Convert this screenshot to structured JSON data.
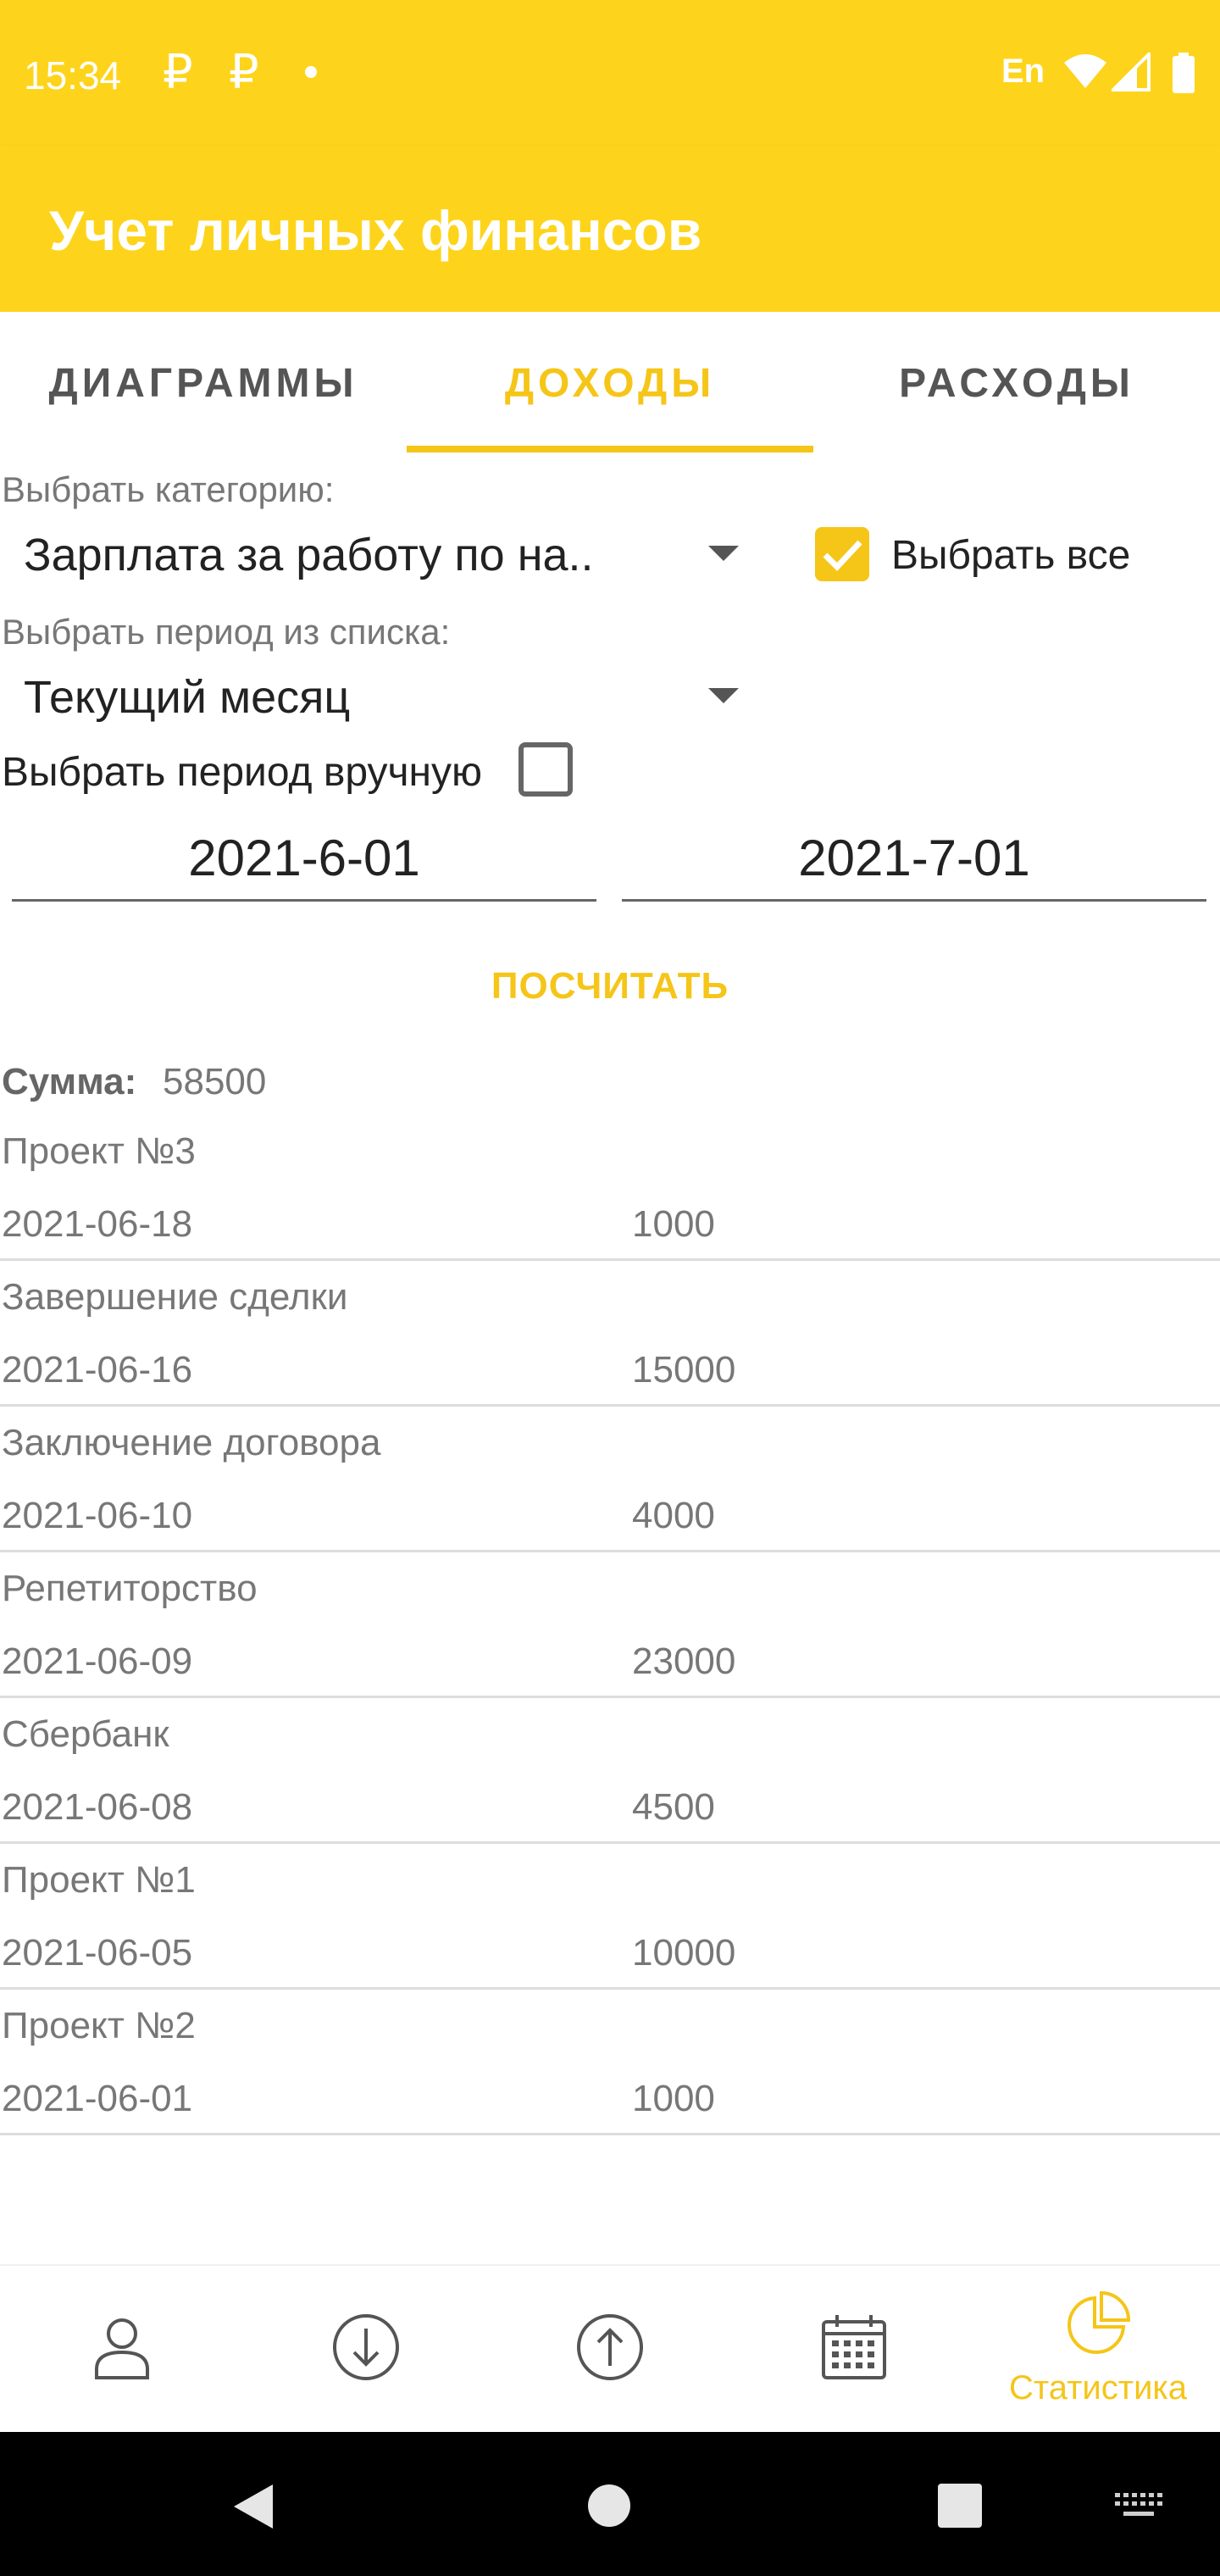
{
  "status_bar": {
    "time": "15:34",
    "notif_icons": [
      "₽",
      "₽"
    ],
    "language": "En"
  },
  "app": {
    "title": "Учет личных финансов",
    "accent_color": "#F5C518",
    "bar_color": "#FDD41B"
  },
  "tabs": [
    {
      "label": "ДИАГРАММЫ",
      "active": false
    },
    {
      "label": "ДОХОДЫ",
      "active": true
    },
    {
      "label": "РАСХОДЫ",
      "active": false
    }
  ],
  "filters": {
    "category_label": "Выбрать категорию:",
    "category_value": "Зарплата за работу по на..",
    "select_all_label": "Выбрать все",
    "select_all_checked": true,
    "period_label": "Выбрать период из списка:",
    "period_value": "Текущий месяц",
    "manual_period_label": "Выбрать период вручную",
    "manual_period_checked": false,
    "date_from": "2021-6-01",
    "date_to": "2021-7-01"
  },
  "calculate_button": "ПОСЧИТАТЬ",
  "summary": {
    "sum_label": "Сумма:",
    "sum_value": "58500"
  },
  "entries": [
    {
      "title": "Проект №3",
      "date": "2021-06-18",
      "amount": "1000"
    },
    {
      "title": "Завершение сделки",
      "date": "2021-06-16",
      "amount": "15000"
    },
    {
      "title": "Заключение договора",
      "date": "2021-06-10",
      "amount": "4000"
    },
    {
      "title": "Репетиторство",
      "date": "2021-06-09",
      "amount": "23000"
    },
    {
      "title": "Сбербанк",
      "date": "2021-06-08",
      "amount": "4500"
    },
    {
      "title": "Проект №1",
      "date": "2021-06-05",
      "amount": "10000"
    },
    {
      "title": "Проект №2",
      "date": "2021-06-01",
      "amount": "1000"
    }
  ],
  "bottom_nav": [
    {
      "icon": "person-icon",
      "label": ""
    },
    {
      "icon": "arrow-down-circle-icon",
      "label": ""
    },
    {
      "icon": "arrow-up-circle-icon",
      "label": ""
    },
    {
      "icon": "calendar-icon",
      "label": ""
    },
    {
      "icon": "pie-chart-icon",
      "label": "Статистика",
      "active": true
    }
  ]
}
